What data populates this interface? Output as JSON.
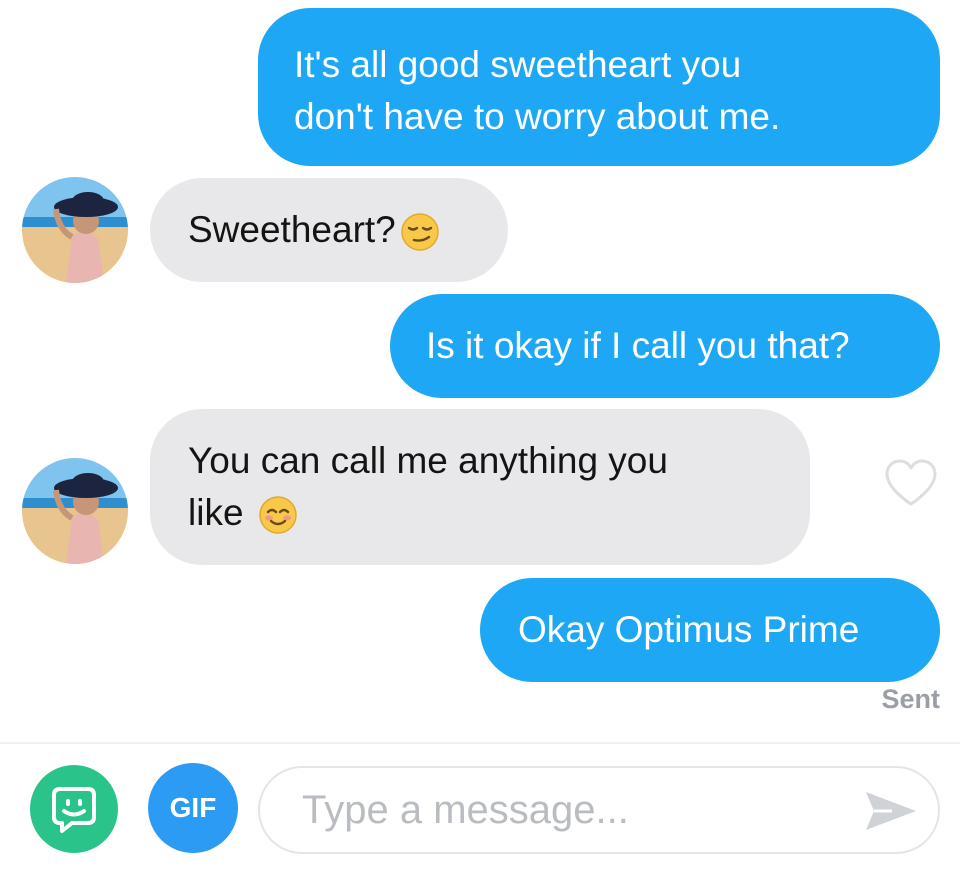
{
  "messages": [
    {
      "direction": "outgoing",
      "line1": "It's all good sweetheart you",
      "line2": "don't have to worry about me."
    },
    {
      "direction": "incoming",
      "text": "Sweetheart?",
      "emoji": "smirk-emoji"
    },
    {
      "direction": "outgoing",
      "text": "Is it okay if I call you that?"
    },
    {
      "direction": "incoming",
      "line1": "You can call me anything you",
      "line2": "like",
      "emoji": "smiling-emoji"
    },
    {
      "direction": "outgoing",
      "text": "Okay Optimus Prime"
    }
  ],
  "status": {
    "sent_label": "Sent"
  },
  "composer": {
    "gif_label": "GIF",
    "placeholder": "Type a message...",
    "icons": [
      "bitmoji-icon",
      "send-icon",
      "heart-icon"
    ]
  },
  "colors": {
    "outgoing_bubble": "#1ea7f5",
    "incoming_bubble": "#e8e8ea",
    "bitmoji_button": "#2ac48b",
    "gif_button": "#2b9bf4",
    "sent_text": "#9a9ea5"
  }
}
